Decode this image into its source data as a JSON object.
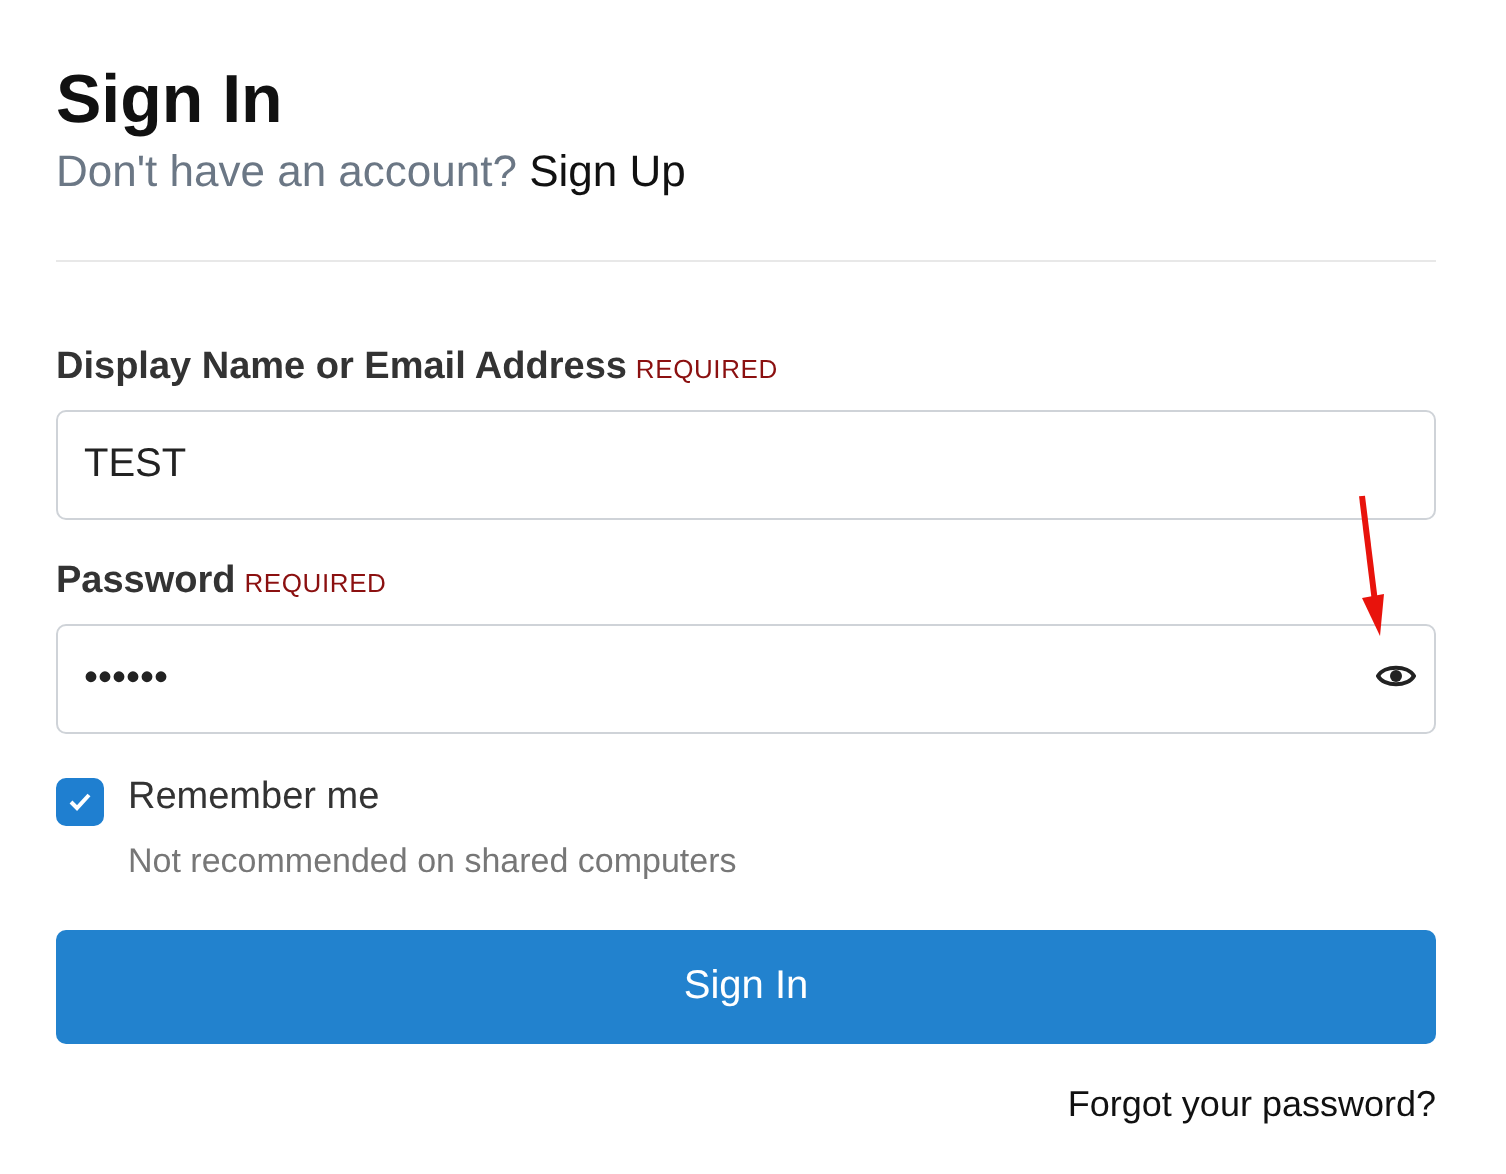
{
  "title": "Sign In",
  "subtitle": {
    "text": "Don't have an account?",
    "link": "Sign Up"
  },
  "fields": [
    {
      "label": "Display Name or Email Address",
      "required": "REQUIRED",
      "value": "TEST",
      "reveal": false
    },
    {
      "label": "Password",
      "required": "REQUIRED",
      "value": "••••••",
      "reveal": true
    }
  ],
  "remember": {
    "label": "Remember me",
    "checked": true,
    "hint": "Not recommended on shared computers"
  },
  "submit": "Sign In",
  "forgot": "Forgot your password?"
}
